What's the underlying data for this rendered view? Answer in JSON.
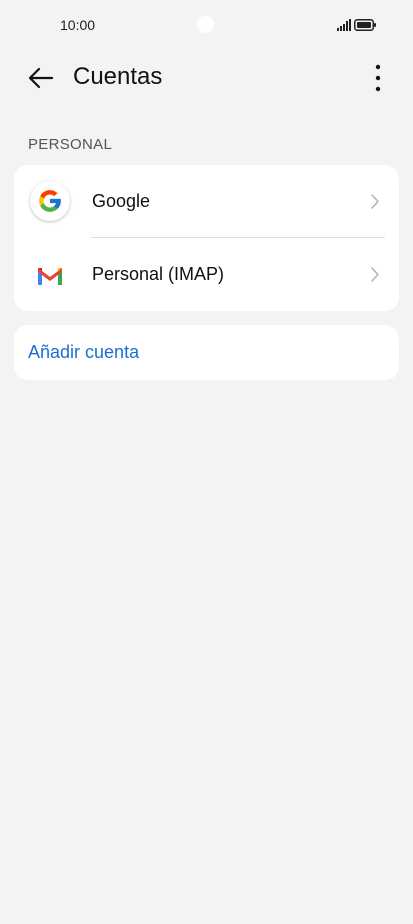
{
  "status_bar": {
    "time": "10:00"
  },
  "header": {
    "title": "Cuentas"
  },
  "section": {
    "label": "PERSONAL"
  },
  "accounts": [
    {
      "label": "Google",
      "icon": "google-logo-icon"
    },
    {
      "label": "Personal (IMAP)",
      "icon": "gmail-logo-icon"
    }
  ],
  "add_account": {
    "label": "Añadir cuenta"
  },
  "colors": {
    "background": "#f1f3f5",
    "card": "#ffffff",
    "accent": "#1a6fd6"
  }
}
